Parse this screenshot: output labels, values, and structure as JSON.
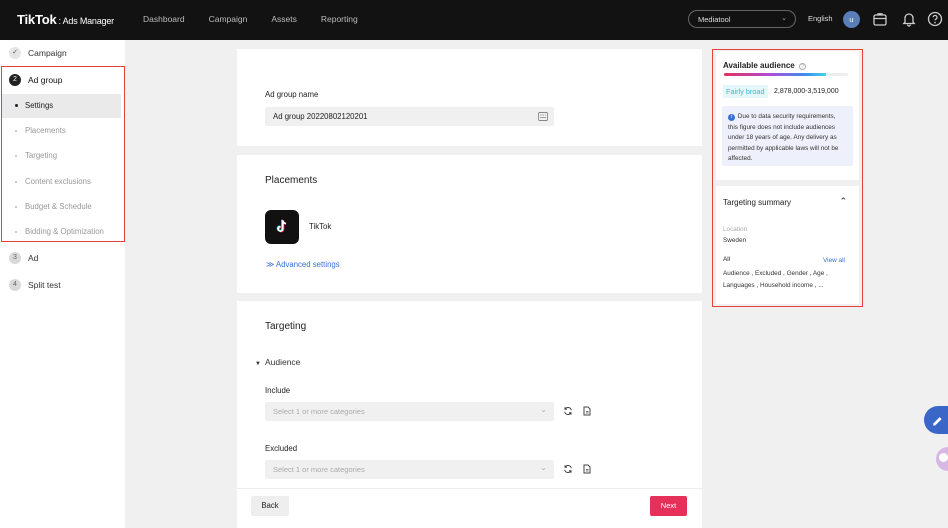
{
  "brand": {
    "logo": "TikTok",
    "product": ": Ads Manager"
  },
  "nav": [
    "Dashboard",
    "Campaign",
    "Assets",
    "Reporting"
  ],
  "account": {
    "name": "Mediatool"
  },
  "language": "English",
  "avatar": "u",
  "sidebar": {
    "steps": [
      {
        "num": "✓",
        "label": "Campaign"
      },
      {
        "num": "2",
        "label": "Ad group"
      },
      {
        "num": "3",
        "label": "Ad"
      },
      {
        "num": "4",
        "label": "Split test"
      }
    ],
    "subitems": [
      "Settings",
      "Placements",
      "Targeting",
      "Content exclusions",
      "Budget & Schedule",
      "Bidding & Optimization"
    ]
  },
  "form": {
    "ad_group_name_label": "Ad group name",
    "ad_group_name_value": "Ad group 20220802120201",
    "placements_title": "Placements",
    "placement_name": "TikTok",
    "advanced_settings": "Advanced settings",
    "targeting_title": "Targeting",
    "audience_label": "Audience",
    "include_label": "Include",
    "include_placeholder": "Select 1 or more categories",
    "excluded_label": "Excluded",
    "excluded_placeholder": "Select 1 or more categories"
  },
  "buttons": {
    "back": "Back",
    "next": "Next"
  },
  "audience_panel": {
    "title": "Available audience",
    "breadth_label": "Fairly broad",
    "range": "2,878,000-3,519,000",
    "meter_fill_pct": 82,
    "note": "Due to data security requirements, this figure does not include audiences under 18 years of age. Any delivery as permitted by applicable laws will not be affected."
  },
  "targeting_summary": {
    "title": "Targeting summary",
    "location_label": "Location",
    "location_value": "Sweden",
    "all_label": "All",
    "view_all": "View all",
    "line1": "Audience , Excluded , Gender , Age ,",
    "line2": "Languages , Household income , ..."
  },
  "colors": {
    "accent_red": "#e5305a",
    "link_blue": "#3b6fd8",
    "highlight_box": "#e5433a"
  }
}
